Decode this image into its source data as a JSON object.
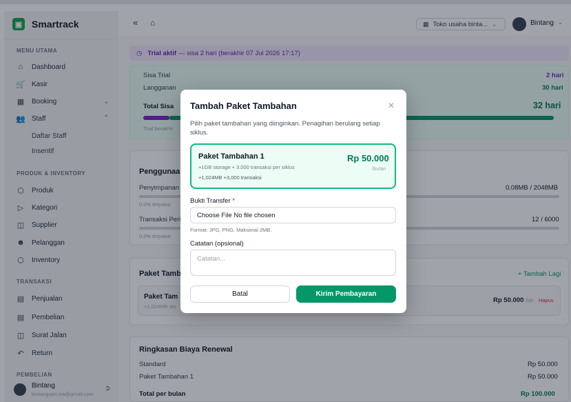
{
  "brand": {
    "name": "Smartrack"
  },
  "sidebar": {
    "section_main": "MENU UTAMA",
    "section_products": "PRODUK & INVENTORY",
    "section_transactions": "TRANSAKSI",
    "section_purchase": "PEMBELIAN",
    "items": {
      "dashboard": "Dashboard",
      "kasir": "Kasir",
      "booking": "Booking",
      "staff": "Staff",
      "daftar_staff": "Daftar Staff",
      "insentif": "Insentif",
      "produk": "Produk",
      "kategori": "Kategori",
      "supplier": "Supplier",
      "pelanggan": "Pelanggan",
      "inventory": "Inventory",
      "penjualan": "Penjualan",
      "pembelian": "Pembelian",
      "surat_jalan": "Surat Jalan",
      "return": "Return"
    },
    "user": {
      "name": "Bintang",
      "email": "bintangsari.sia@gmail.com"
    }
  },
  "topbar": {
    "store": "Toko usaha binta...",
    "user": "Bintang"
  },
  "main": {
    "trial_banner": {
      "bold": "Trial aktif",
      "text": "— sisa 2 hari (berakhir 07 Jul 2026 17:17)"
    },
    "trial_card": {
      "sisa_trial_label": "Sisa Trial",
      "sisa_trial_value": "2 hari",
      "langganan_label": "Langganan",
      "langganan_value": "30 hari",
      "total_label": "Total Sisa",
      "total_value": "32 hari",
      "note": "Trial berakhir"
    },
    "usage": {
      "title": "Penggunaan",
      "storage_label": "Penyimpanan",
      "storage_value": "0.08MB / 2048MB",
      "storage_pct": "0.0% terpakai",
      "trx_label": "Transaksi Peri",
      "trx_value": "12 / 6000",
      "trx_pct": "0.2% terpakai"
    },
    "addons": {
      "title": "Paket Tamb",
      "add_more": "+ Tambah Lagi",
      "item_name": "Paket Tam",
      "item_desc": "+1,024MB sto",
      "item_price": "Rp 50.000",
      "item_unit": "/bln",
      "remove": "Hapus"
    },
    "renewal": {
      "title": "Ringkasan Biaya Renewal",
      "standard_label": "Standard",
      "standard_value": "Rp 50.000",
      "addon_label": "Paket Tambahan 1",
      "addon_value": "Rp 50.000",
      "total_label": "Total per bulan",
      "total_value": "Rp 100.000"
    }
  },
  "modal": {
    "title": "Tambah Paket Tambahan",
    "description": "Pilih paket tambahan yang diinginkan. Penagihan berulang setiap siklus.",
    "package": {
      "name": "Paket Tambahan 1",
      "desc": "+1GB storage + 3.000 transaksi per siklus",
      "tags": "+1,024MB   +3,000 transaksi",
      "price": "Rp 50.000",
      "unit": "/bulan"
    },
    "file_label": "Bukti Transfer",
    "file_required": "*",
    "file_value": "Choose File No file chosen",
    "file_hint": "Format: JPG, PNG. Maksimal 2MB.",
    "notes_label": "Catatan (opsional)",
    "notes_placeholder": "Catatan...",
    "cancel": "Batal",
    "submit": "Kirim Pembayaran"
  },
  "colors": {
    "brand": "#16a34a",
    "primary": "#059669",
    "trial_purple": "#7e22ce"
  }
}
